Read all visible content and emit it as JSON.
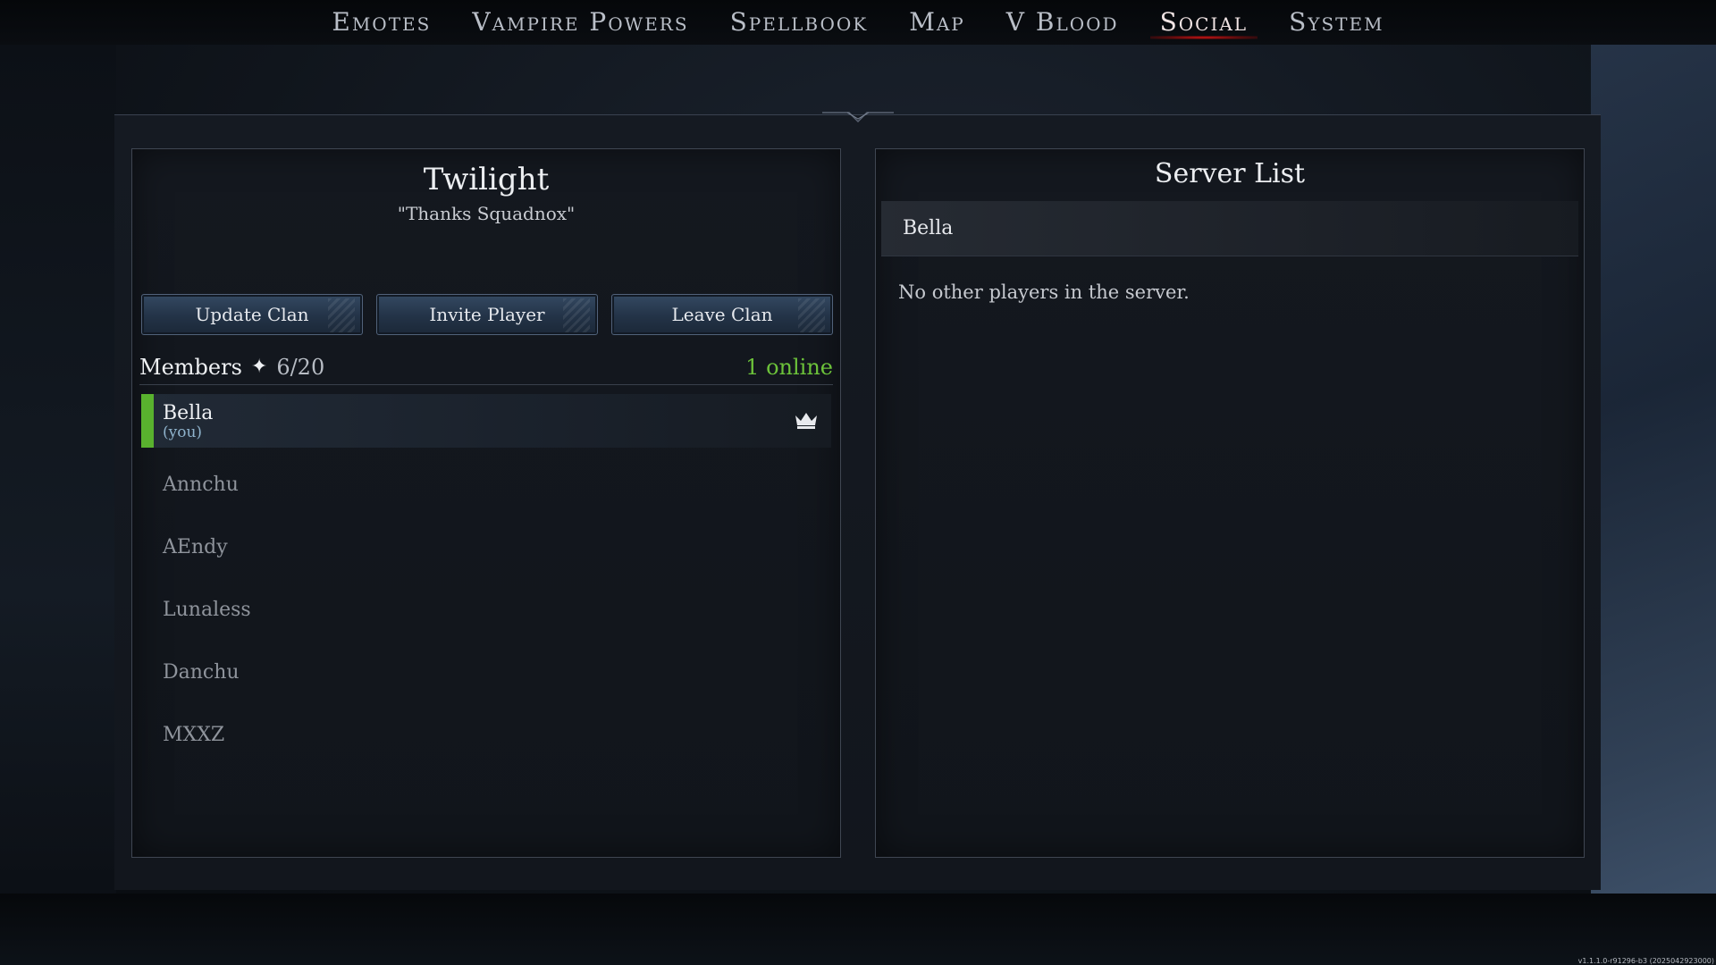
{
  "nav": {
    "items": [
      {
        "label": "Emotes"
      },
      {
        "label": "Vampire Powers"
      },
      {
        "label": "Spellbook"
      },
      {
        "label": "Map"
      },
      {
        "label": "V Blood"
      },
      {
        "label": "Social"
      },
      {
        "label": "System"
      }
    ],
    "active": "Social"
  },
  "clan": {
    "name": "Twilight",
    "motto": "\"Thanks Squadnox\"",
    "buttons": {
      "update": "Update Clan",
      "invite": "Invite Player",
      "leave": "Leave Clan"
    },
    "members_label": "Members",
    "members_count": "6/20",
    "online": "1 online",
    "members": [
      {
        "name": "Bella",
        "tag": "(you)"
      },
      {
        "name": "Annchu"
      },
      {
        "name": "AEndy"
      },
      {
        "name": "Lunaless"
      },
      {
        "name": "Danchu"
      },
      {
        "name": "MXXZ"
      }
    ]
  },
  "server": {
    "title": "Server List",
    "current_player": "Bella",
    "empty_message": "No other players in the server."
  },
  "version": "v1.1.1.0-r91296-b3 (2025042923000)",
  "colors": {
    "accent_red": "#d31616",
    "online_green": "#6cc23a",
    "self_marker": "#59b22e"
  }
}
